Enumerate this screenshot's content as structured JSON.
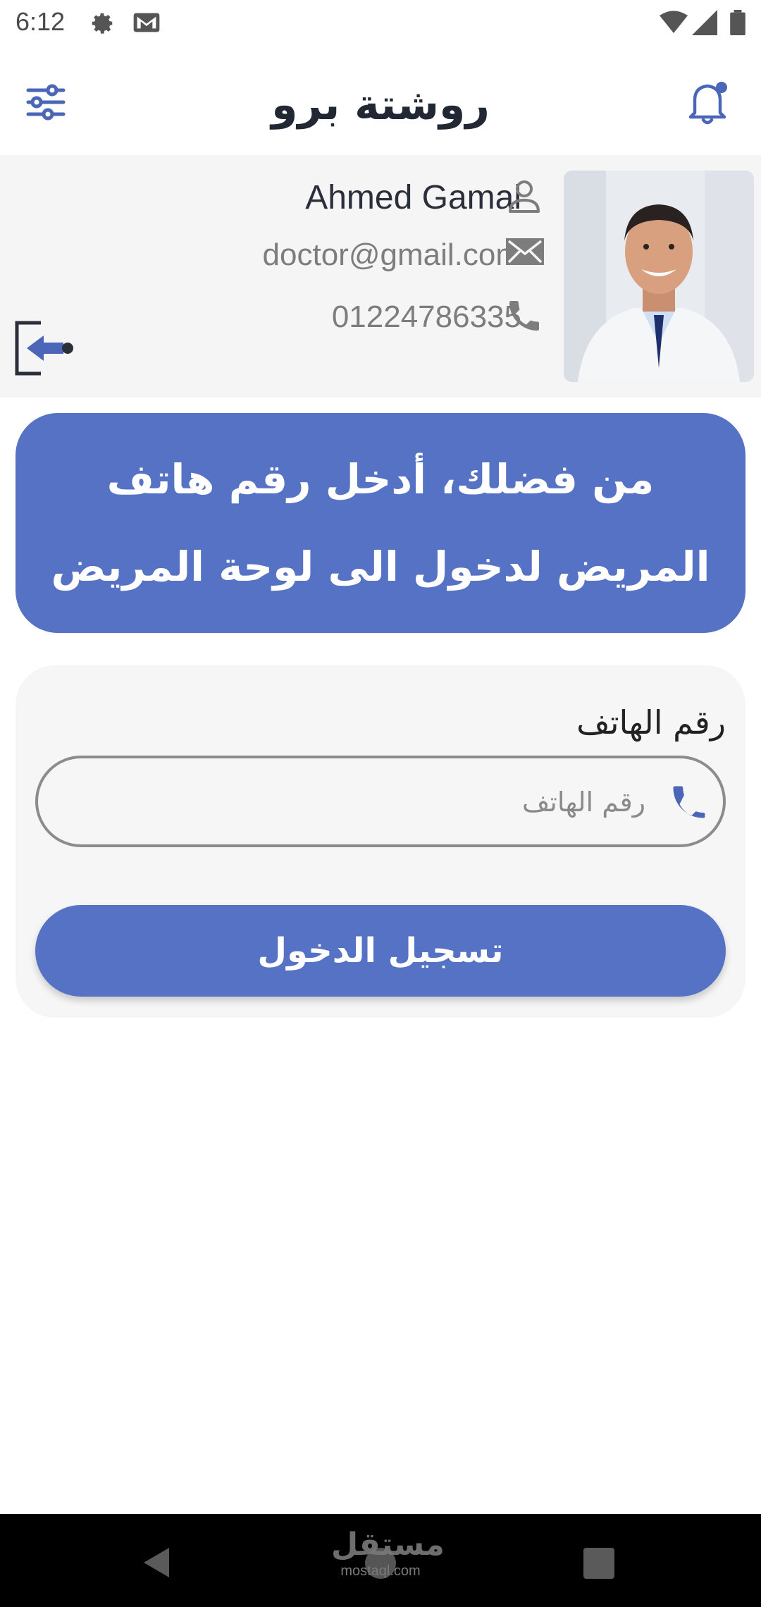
{
  "status_bar": {
    "time": "6:12",
    "icons": [
      "gear-icon",
      "gmail-icon",
      "wifi-icon",
      "signal-icon",
      "battery-icon"
    ]
  },
  "app_bar": {
    "title": "روشتة برو",
    "left_icon": "filter-sliders-icon",
    "right_icon": "notification-bell-icon"
  },
  "profile": {
    "name": "Ahmed Gamal",
    "email": "doctor@gmail.com",
    "phone": "01224786335",
    "icons": {
      "name": "person-icon",
      "email": "mail-icon",
      "phone": "phone-icon",
      "logout": "logout-icon"
    }
  },
  "banner": {
    "line1": "من فضلك، أدخل رقم هاتف",
    "line2": "المريض لدخول الى لوحة المريض"
  },
  "form": {
    "field_label": "رقم الهاتف",
    "phone_placeholder": "رقم الهاتف",
    "phone_value": "",
    "submit_label": "تسجيل الدخول"
  },
  "nav_bar": {
    "watermark": "مستقل",
    "watermark_sub": "mostaql.com"
  },
  "colors": {
    "accent": "#5572c4",
    "background": "#ffffff",
    "card": "#f5f5f5"
  }
}
